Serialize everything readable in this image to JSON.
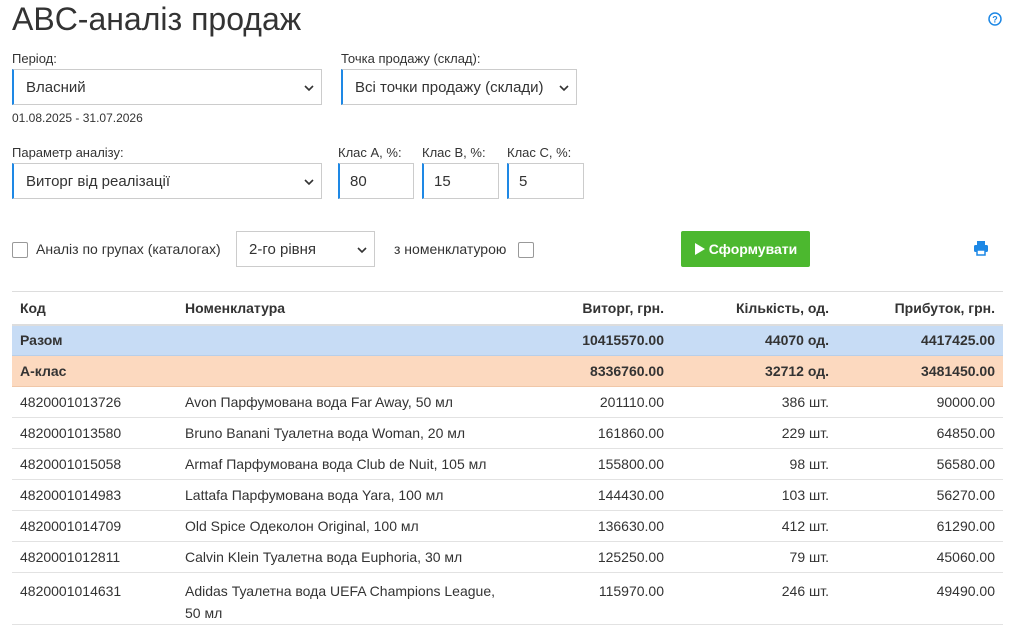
{
  "header": {
    "title": "ABC-аналіз продаж"
  },
  "filters": {
    "period_label": "Період:",
    "period_value": "Власний",
    "date_range": "01.08.2025 - 31.07.2026",
    "point_label": "Точка продажу (склад):",
    "point_value": "Всі точки продажу (склади)",
    "param_label": "Параметр аналізу:",
    "param_value": "Виторг від реалізації",
    "class_a_label": "Клас A, %:",
    "class_a_value": "80",
    "class_b_label": "Клас B, %:",
    "class_b_value": "15",
    "class_c_label": "Клас C, %:",
    "class_c_value": "5",
    "group_analysis_label": "Аналіз по групах (каталогах)",
    "group_level_value": "2-го рівня",
    "with_nomenclature_label": "з номенклатурою",
    "generate_label": "Сформувати"
  },
  "table": {
    "headers": {
      "code": "Код",
      "name": "Номенклатура",
      "revenue": "Виторг, грн.",
      "qty": "Кількість, од.",
      "profit": "Прибуток, грн."
    },
    "total": {
      "label": "Разом",
      "revenue": "10415570.00",
      "qty": "44070 од.",
      "profit": "4417425.00"
    },
    "class_a": {
      "label": "А-клас",
      "revenue": "8336760.00",
      "qty": "32712 од.",
      "profit": "3481450.00"
    },
    "rows": [
      {
        "code": "4820001013726",
        "name": "Avon Парфумована вода Far Away, 50 мл",
        "revenue": "201110.00",
        "qty": "386 шт.",
        "profit": "90000.00"
      },
      {
        "code": "4820001013580",
        "name": "Bruno Banani Туалетна вода Woman, 20 мл",
        "revenue": "161860.00",
        "qty": "229 шт.",
        "profit": "64850.00"
      },
      {
        "code": "4820001015058",
        "name": "Armaf Парфумована вода Club de Nuit, 105 мл",
        "revenue": "155800.00",
        "qty": "98 шт.",
        "profit": "56580.00"
      },
      {
        "code": "4820001014983",
        "name": "Lattafa Парфумована вода Yara, 100 мл",
        "revenue": "144430.00",
        "qty": "103 шт.",
        "profit": "56270.00"
      },
      {
        "code": "4820001014709",
        "name": "Old Spice Одеколон Original, 100 мл",
        "revenue": "136630.00",
        "qty": "412 шт.",
        "profit": "61290.00"
      },
      {
        "code": "4820001012811",
        "name": "Calvin Klein Туалетна вода Euphoria, 30 мл",
        "revenue": "125250.00",
        "qty": "79 шт.",
        "profit": "45060.00"
      },
      {
        "code": "4820001014631",
        "name": "Adidas Туалетна вода UEFA Champions League, 50 мл",
        "revenue": "115970.00",
        "qty": "246 шт.",
        "profit": "49490.00"
      }
    ]
  },
  "colors": {
    "accent": "#1e88e5",
    "button": "#4cb82f",
    "total_row": "#c7dcf5",
    "class_a_row": "#fcd9bf"
  }
}
